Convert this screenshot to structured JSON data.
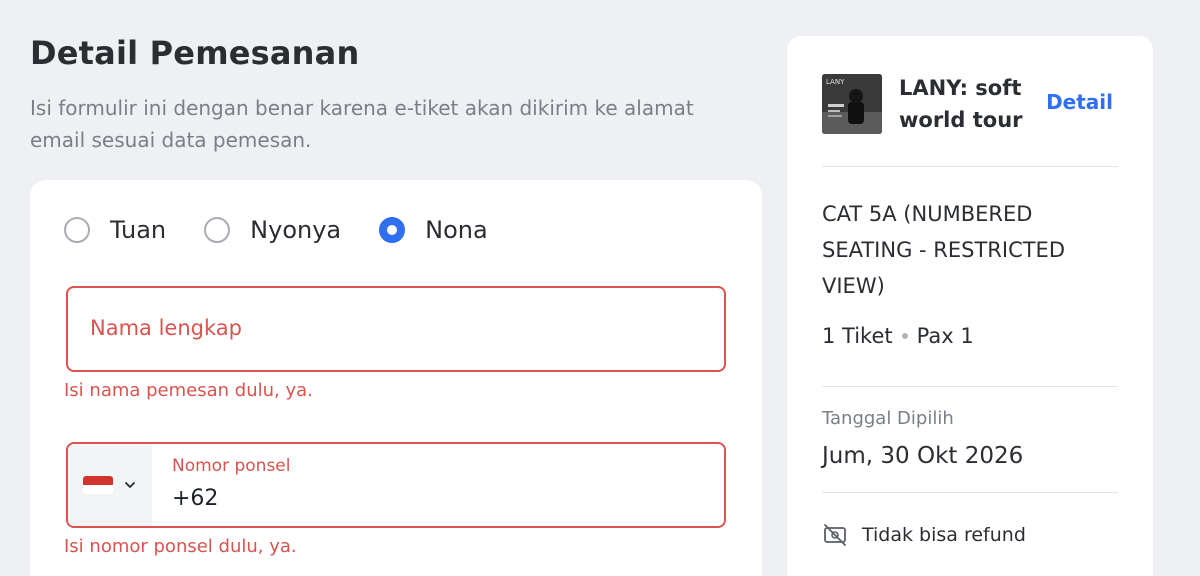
{
  "header": {
    "title": "Detail Pemesanan",
    "subtitle": "Isi formulir ini dengan benar karena e-tiket akan dikirim ke alamat email sesuai data pemesan."
  },
  "form": {
    "titles": [
      {
        "label": "Tuan",
        "checked": false
      },
      {
        "label": "Nyonya",
        "checked": false
      },
      {
        "label": "Nona",
        "checked": true
      }
    ],
    "name_placeholder": "Nama lengkap",
    "name_error": "Isi nama pemesan dulu, ya.",
    "phone_label": "Nomor ponsel",
    "phone_value": "+62",
    "phone_error": "Isi nomor ponsel dulu, ya.",
    "country_flag": "indonesia-flag-icon"
  },
  "summary": {
    "event_title": "LANY: soft world tour",
    "thumb_text": "LANY",
    "detail_label": "Detail",
    "category": "CAT 5A (NUMBERED SEATING - RESTRICTED VIEW)",
    "tickets": "1 Tiket",
    "pax": "Pax 1",
    "date_label": "Tanggal Dipilih",
    "date_value": "Jum, 30 Okt 2026",
    "refund": "Tidak bisa refund"
  },
  "colors": {
    "accent": "#2f6ff0",
    "error": "#d9534f",
    "background": "#eff0f4"
  }
}
